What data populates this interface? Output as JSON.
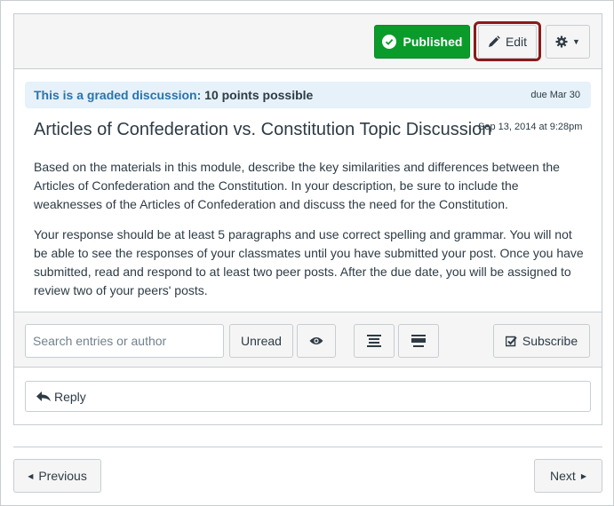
{
  "toolbar": {
    "published_label": "Published",
    "edit_label": "Edit",
    "settings_caret": "▼"
  },
  "discussion": {
    "graded_lead": "This is a graded discussion:",
    "graded_points": "10 points possible",
    "due": "due Mar 30",
    "title": "Articles of Confederation vs. Constitution Topic Discussion",
    "timestamp": "Sep 13, 2014 at 9:28pm",
    "paragraphs": [
      "Based on the materials in this module, describe the key similarities and differences between the Articles of Confederation and the Constitution. In your description, be sure to include the weaknesses of the Articles of Confederation and discuss the need for the Constitution.",
      "Your response should be at least 5 paragraphs and use correct spelling and grammar. You will not be able to see the responses of your classmates until you have submitted your post. Once you have submitted, read and respond to at least two peer posts. After the due date, you will be assigned to review two of your peers' posts."
    ]
  },
  "filters": {
    "search_placeholder": "Search entries or author",
    "unread_label": "Unread",
    "subscribe_label": "Subscribe"
  },
  "reply": {
    "label": "Reply"
  },
  "pagination": {
    "previous_label": "Previous",
    "next_label": "Next"
  },
  "colors": {
    "published_green": "#0b9b2b",
    "edit_highlight": "#8b1a1a",
    "graded_bg": "#e6f1f9",
    "graded_lead": "#2774af"
  }
}
